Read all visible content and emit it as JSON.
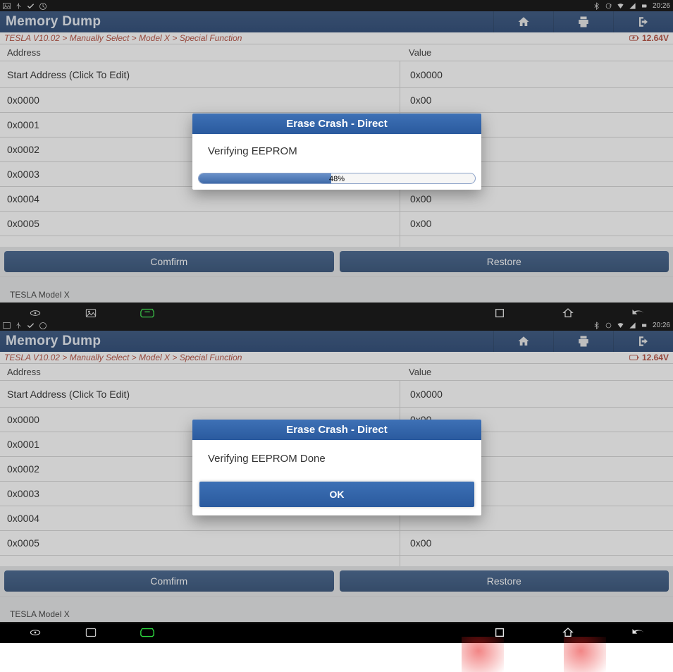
{
  "statusbar": {
    "time": "20:26"
  },
  "top": {
    "title": "Memory Dump",
    "breadcrumb": "TESLA V10.02 > Manually Select > Model X > Special Function",
    "voltage": "12.64V",
    "header_addr": "Address",
    "header_val": "Value",
    "rows": [
      {
        "addr": "Start Address (Click To Edit)",
        "val": "0x0000",
        "cls": "start-row"
      },
      {
        "addr": "0x0000",
        "val": "0x00",
        "cls": "data-row"
      },
      {
        "addr": "0x0001",
        "val": "",
        "cls": "data-row"
      },
      {
        "addr": "0x0002",
        "val": "",
        "cls": "data-row"
      },
      {
        "addr": "0x0003",
        "val": "",
        "cls": "data-row"
      },
      {
        "addr": "0x0004",
        "val": "0x00",
        "cls": "data-row"
      },
      {
        "addr": "0x0005",
        "val": "0x00",
        "cls": "data-row"
      },
      {
        "addr": "",
        "val": "",
        "cls": "part-row"
      }
    ],
    "confirm": "Comfirm",
    "restore": "Restore",
    "footer": "TESLA Model X",
    "modal": {
      "title": "Erase Crash - Direct",
      "msg": "Verifying EEPROM",
      "pct": "48%"
    }
  },
  "bottom": {
    "title": "Memory Dump",
    "breadcrumb": "TESLA V10.02 > Manually Select > Model X > Special Function",
    "voltage": "12.64V",
    "header_addr": "Address",
    "header_val": "Value",
    "rows": [
      {
        "addr": "Start Address (Click To Edit)",
        "val": "0x0000",
        "cls": "start-row"
      },
      {
        "addr": "0x0000",
        "val": "0x00",
        "cls": "data-row"
      },
      {
        "addr": "0x0001",
        "val": "",
        "cls": "data-row"
      },
      {
        "addr": "0x0002",
        "val": "",
        "cls": "data-row"
      },
      {
        "addr": "0x0003",
        "val": "",
        "cls": "data-row"
      },
      {
        "addr": "0x0004",
        "val": "",
        "cls": "data-row"
      },
      {
        "addr": "0x0005",
        "val": "0x00",
        "cls": "data-row"
      },
      {
        "addr": "",
        "val": "",
        "cls": "part-row"
      }
    ],
    "confirm": "Comfirm",
    "restore": "Restore",
    "footer": "TESLA Model X",
    "modal": {
      "title": "Erase Crash - Direct",
      "msg": "Verifying EEPROM Done",
      "ok": "OK"
    }
  }
}
